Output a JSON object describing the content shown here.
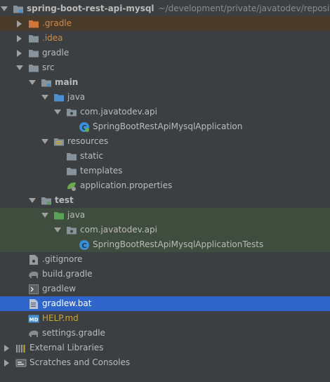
{
  "tree": {
    "root": {
      "label": "spring-boot-rest-api-mysql",
      "path": "~/development/private/javatodev/repositories/"
    },
    "gradle_dir": ".gradle",
    "idea_dir": ".idea",
    "gradle": "gradle",
    "src": "src",
    "main": "main",
    "main_java": "java",
    "main_pkg": "com.javatodev.api",
    "main_app": "SpringBootRestApiMysqlApplication",
    "resources": "resources",
    "static": "static",
    "templates": "templates",
    "app_props": "application.properties",
    "test": "test",
    "test_java": "java",
    "test_pkg": "com.javatodev.api",
    "test_app": "SpringBootRestApiMysqlApplicationTests",
    "gitignore": ".gitignore",
    "build_gradle": "build.gradle",
    "gradlew": "gradlew",
    "gradlew_bat": "gradlew.bat",
    "help_md": "HELP.md",
    "settings_gradle": "settings.gradle",
    "external_libraries": "External Libraries",
    "scratches": "Scratches and Consoles"
  },
  "colors": {
    "background": "#3c3f41",
    "selection": "#2f65ca",
    "excluded_bg": "#4a3a2a",
    "test_bg": "#3f4d3f",
    "folder": "#87939a",
    "source_folder": "#4a8fcf",
    "test_folder": "#5aa356"
  }
}
